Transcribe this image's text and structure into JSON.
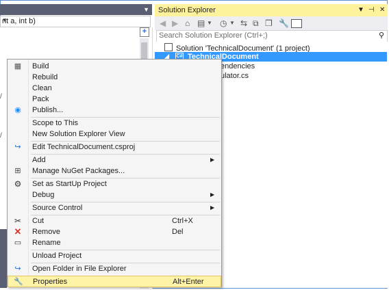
{
  "editor": {
    "signature": "nt a, int b)",
    "margin_marks": [
      "/",
      "/"
    ]
  },
  "solution_explorer": {
    "title": "Solution Explorer",
    "search_placeholder": "Search Solution Explorer (Ctrl+;)",
    "solution_label": "Solution 'TechnicalDocument' (1 project)",
    "project_label": "TechnicalDocument",
    "child_1": "endencies",
    "child_2": "ulator.cs"
  },
  "context_menu": {
    "items": [
      {
        "label": "Build",
        "icon": "build-icon"
      },
      {
        "label": "Rebuild"
      },
      {
        "label": "Clean"
      },
      {
        "label": "Pack"
      },
      {
        "label": "Publish...",
        "icon": "publish-icon"
      },
      {
        "label": "Scope to This"
      },
      {
        "label": "New Solution Explorer View"
      },
      {
        "label": "Edit TechnicalDocument.csproj",
        "icon": "edit-project-icon"
      },
      {
        "label": "Add",
        "submenu": true
      },
      {
        "label": "Manage NuGet Packages...",
        "icon": "nuget-icon"
      },
      {
        "label": "Set as StartUp Project",
        "icon": "gear-icon"
      },
      {
        "label": "Debug",
        "submenu": true
      },
      {
        "label": "Source Control",
        "submenu": true
      },
      {
        "label": "Cut",
        "shortcut": "Ctrl+X",
        "icon": "scissors-icon"
      },
      {
        "label": "Remove",
        "shortcut": "Del",
        "icon": "remove-icon"
      },
      {
        "label": "Rename",
        "icon": "rename-icon"
      },
      {
        "label": "Unload Project"
      },
      {
        "label": "Open Folder in File Explorer",
        "icon": "open-folder-icon"
      },
      {
        "label": "Properties",
        "shortcut": "Alt+Enter",
        "icon": "wrench-icon"
      }
    ]
  },
  "colors": {
    "accent_selected": "#3399ff",
    "title_active": "#fff29d",
    "menu_highlight": "#fef3a6"
  }
}
